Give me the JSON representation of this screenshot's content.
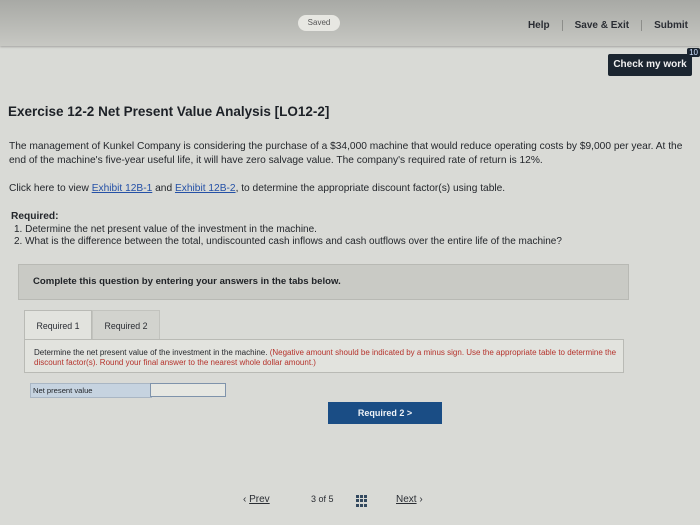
{
  "topbar": {
    "saved": "Saved",
    "help": "Help",
    "save_exit": "Save & Exit",
    "submit": "Submit",
    "check_my_work": "Check my work",
    "check_badge": "10"
  },
  "exercise": {
    "title": "Exercise 12-2 Net Present Value Analysis [LO12-2]",
    "intro": "The management of Kunkel Company is considering the purchase of a $34,000 machine that would reduce operating costs by $9,000 per year. At the end of the machine's five-year useful life, it will have zero salvage value. The company's required rate of return is 12%.",
    "exhibits_prefix": "Click here to view",
    "exhibit1": "Exhibit 12B-1",
    "exhibits_and": "and",
    "exhibit2": "Exhibit 12B-2",
    "exhibits_suffix": ", to determine the appropriate discount factor(s) using table.",
    "required_label": "Required:",
    "req1": "1. Determine the net present value of the investment in the machine.",
    "req2": "2. What is the difference between the total, undiscounted cash inflows and cash outflows over the entire life of the machine?"
  },
  "complete_box": "Complete this question by entering your answers in the tabs below.",
  "tabs": [
    "Required 1",
    "Required 2"
  ],
  "panel": {
    "instruction": "Determine the net present value of the investment in the machine.",
    "note": "(Negative amount should be indicated by a minus sign. Use the appropriate table to determine the discount factor(s). Round your final answer to the nearest whole dollar amount.)",
    "npv_label": "Net present value",
    "npv_value": ""
  },
  "nav_button": "Required 2  >",
  "pager": {
    "prev": "Prev",
    "page": "3 of 5",
    "next": "Next"
  }
}
